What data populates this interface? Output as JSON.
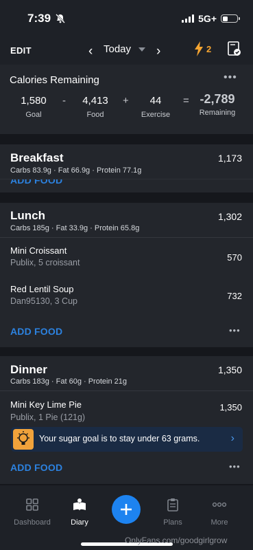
{
  "status_bar": {
    "time": "7:39",
    "network": "5G+"
  },
  "topbar": {
    "edit_label": "EDIT",
    "date_label": "Today",
    "streak_count": "2"
  },
  "calories": {
    "title": "Calories Remaining",
    "goal": {
      "value": "1,580",
      "label": "Goal"
    },
    "minus": "-",
    "food": {
      "value": "4,413",
      "label": "Food"
    },
    "plus": "+",
    "exercise": {
      "value": "44",
      "label": "Exercise"
    },
    "equals": "=",
    "remaining": {
      "value": "-2,789",
      "label": "Remaining"
    }
  },
  "breakfast": {
    "title": "Breakfast",
    "calories": "1,173",
    "macros": "Carbs 83.9g · Fat 66.9g · Protein 77.1g",
    "add_label": "ADD FOOD"
  },
  "lunch": {
    "title": "Lunch",
    "calories": "1,302",
    "macros": "Carbs 185g · Fat 33.9g · Protein 65.8g",
    "items": [
      {
        "name": "Mini Croissant",
        "desc": "Publix, 5 croissant",
        "calories": "570"
      },
      {
        "name": "Red Lentil Soup",
        "desc": "Dan95130, 3 Cup",
        "calories": "732"
      }
    ],
    "add_label": "ADD FOOD"
  },
  "dinner": {
    "title": "Dinner",
    "calories": "1,350",
    "macros": "Carbs 183g · Fat 60g · Protein 21g",
    "items": [
      {
        "name": "Mini Key Lime Pie",
        "desc": "Publix, 1 Pie (121g)",
        "calories": "1,350"
      }
    ],
    "tip": "Your sugar goal is to stay under 63 grams.",
    "add_label": "ADD FOOD"
  },
  "tabs": [
    {
      "label": "Dashboard",
      "icon": "dashboard-icon"
    },
    {
      "label": "Diary",
      "icon": "diary-icon"
    },
    {
      "label": "",
      "icon": "plus-icon"
    },
    {
      "label": "Plans",
      "icon": "plans-icon"
    },
    {
      "label": "More",
      "icon": "more-icon"
    }
  ],
  "watermark": "OnlyFans.com/goodgirlgrow",
  "colors": {
    "accent": "#2c82e0",
    "fab": "#1d83f0",
    "streak": "#f6a531",
    "tip_bg": "#1a2b44"
  }
}
